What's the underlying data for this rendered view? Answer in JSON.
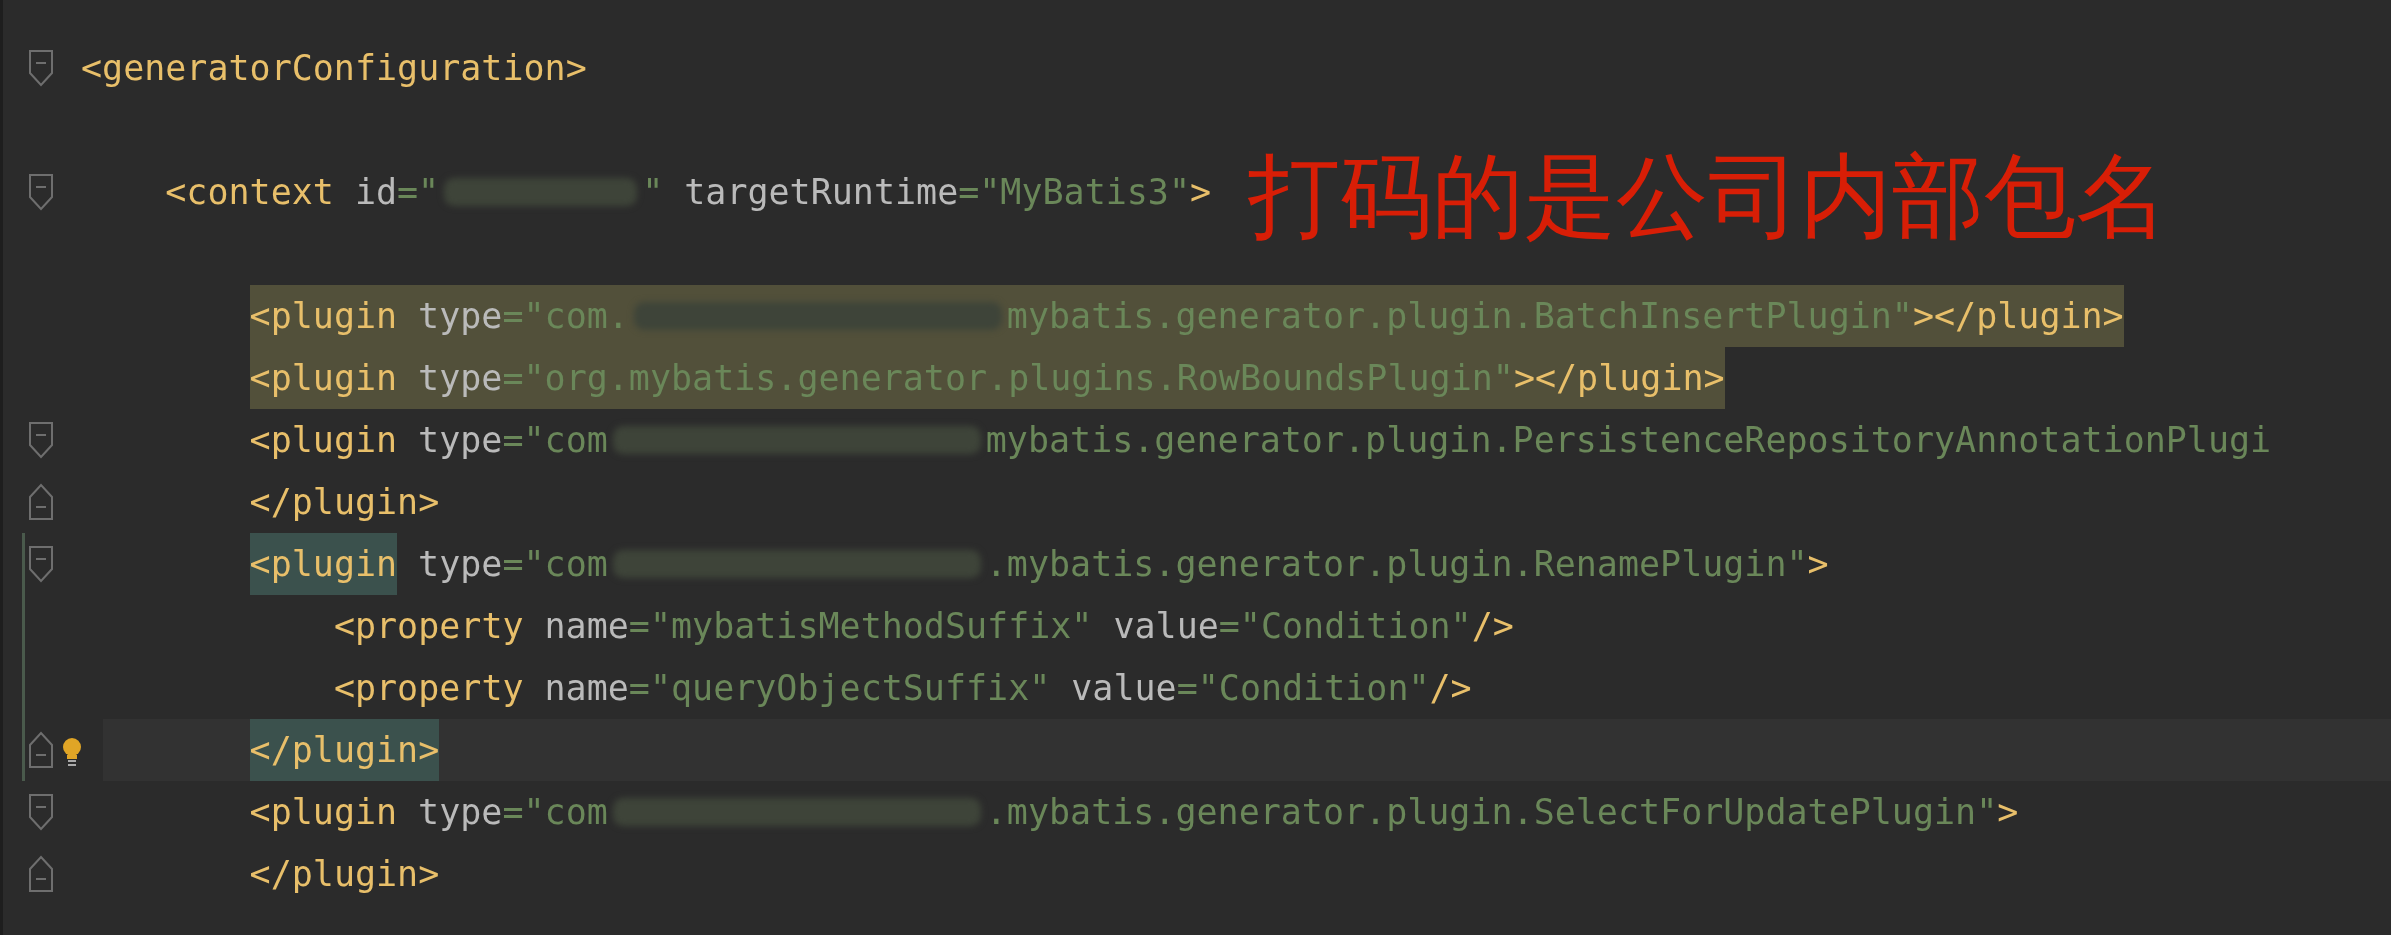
{
  "annotation": {
    "text": "打码的是公司内部包名"
  },
  "lines": [
    {
      "fold_open": true,
      "tokens": [
        {
          "kind": "tag",
          "text": "<generatorConfiguration>"
        }
      ],
      "children": [
        {
          "blank_before": true,
          "fold_open": true,
          "tokens": [
            {
              "kind": "tag",
              "text": "<context"
            },
            {
              "kind": "attr",
              "text": "id"
            },
            {
              "kind": "punct",
              "text": "=\""
            },
            {
              "kind": "blur_short"
            },
            {
              "kind": "punct",
              "text": "\""
            },
            {
              "kind": "attr",
              "text": "targetRuntime"
            },
            {
              "kind": "punct",
              "text": "=\""
            },
            {
              "kind": "string",
              "text": "MyBatis3\""
            },
            {
              "kind": "tag",
              "text": ">"
            }
          ],
          "children": [
            {
              "blank_before": true,
              "highlighted": true,
              "tokens": [
                {
                  "kind": "tag",
                  "text": "<plugin"
                },
                {
                  "kind": "attr",
                  "text": "type"
                },
                {
                  "kind": "punct",
                  "text": "=\""
                },
                {
                  "kind": "string",
                  "text": "com."
                },
                {
                  "kind": "blur_long"
                },
                {
                  "kind": "string",
                  "text": "mybatis.generator.plugin.BatchInsertPlugin\""
                },
                {
                  "kind": "tag",
                  "text": "></plugin>"
                }
              ]
            },
            {
              "highlighted": true,
              "tokens": [
                {
                  "kind": "tag",
                  "text": "<plugin"
                },
                {
                  "kind": "attr",
                  "text": "type"
                },
                {
                  "kind": "punct",
                  "text": "=\""
                },
                {
                  "kind": "string",
                  "text": "org.mybatis.generator.plugins.RowBoundsPlugin\""
                },
                {
                  "kind": "tag",
                  "text": "></plugin>"
                }
              ]
            },
            {
              "fold_open": true,
              "tokens": [
                {
                  "kind": "tag",
                  "text": "<plugin"
                },
                {
                  "kind": "attr",
                  "text": "type"
                },
                {
                  "kind": "punct",
                  "text": "=\""
                },
                {
                  "kind": "string",
                  "text": "com"
                },
                {
                  "kind": "blur_long"
                },
                {
                  "kind": "string",
                  "text": "mybatis.generator.plugin.PersistenceRepositoryAnnotationPlugi"
                }
              ]
            },
            {
              "fold_close": true,
              "tokens": [
                {
                  "kind": "tag",
                  "text": "</plugin>"
                }
              ]
            },
            {
              "fold_open": true,
              "changed": true,
              "tokens": [
                {
                  "kind": "tag",
                  "text": "<plugin",
                  "matched": true
                },
                {
                  "kind": "attr",
                  "text": "type"
                },
                {
                  "kind": "punct",
                  "text": "=\""
                },
                {
                  "kind": "string",
                  "text": "com"
                },
                {
                  "kind": "blur_long"
                },
                {
                  "kind": "string",
                  "text": ".mybatis.generator.plugin.RenamePlugin\""
                },
                {
                  "kind": "tag",
                  "text": ">"
                }
              ],
              "children": [
                {
                  "changed": true,
                  "tokens": [
                    {
                      "kind": "tag",
                      "text": "<property"
                    },
                    {
                      "kind": "attr",
                      "text": "name"
                    },
                    {
                      "kind": "punct",
                      "text": "=\""
                    },
                    {
                      "kind": "string",
                      "text": "mybatisMethodSuffix\""
                    },
                    {
                      "kind": "attr",
                      "text": "value"
                    },
                    {
                      "kind": "punct",
                      "text": "=\""
                    },
                    {
                      "kind": "string",
                      "text": "Condition\""
                    },
                    {
                      "kind": "tag",
                      "text": "/>"
                    }
                  ]
                },
                {
                  "changed": true,
                  "tokens": [
                    {
                      "kind": "tag",
                      "text": "<property"
                    },
                    {
                      "kind": "attr",
                      "text": "name"
                    },
                    {
                      "kind": "punct",
                      "text": "=\""
                    },
                    {
                      "kind": "string",
                      "text": "queryObjectSuffix\""
                    },
                    {
                      "kind": "attr",
                      "text": "value"
                    },
                    {
                      "kind": "punct",
                      "text": "=\""
                    },
                    {
                      "kind": "string",
                      "text": "Condition\""
                    },
                    {
                      "kind": "tag",
                      "text": "/>"
                    }
                  ]
                }
              ]
            },
            {
              "fold_close": true,
              "changed": true,
              "current": true,
              "bulb": true,
              "tokens": [
                {
                  "kind": "tag",
                  "text": "</plugin>",
                  "matched": true
                }
              ]
            },
            {
              "fold_open": true,
              "tokens": [
                {
                  "kind": "tag",
                  "text": "<plugin"
                },
                {
                  "kind": "attr",
                  "text": "type"
                },
                {
                  "kind": "punct",
                  "text": "=\""
                },
                {
                  "kind": "string",
                  "text": "com"
                },
                {
                  "kind": "blur_long"
                },
                {
                  "kind": "string",
                  "text": ".mybatis.generator.plugin.SelectForUpdatePlugin\""
                },
                {
                  "kind": "tag",
                  "text": ">"
                }
              ]
            },
            {
              "fold_close": true,
              "tokens": [
                {
                  "kind": "tag",
                  "text": "</plugin>"
                }
              ]
            }
          ]
        }
      ]
    }
  ]
}
